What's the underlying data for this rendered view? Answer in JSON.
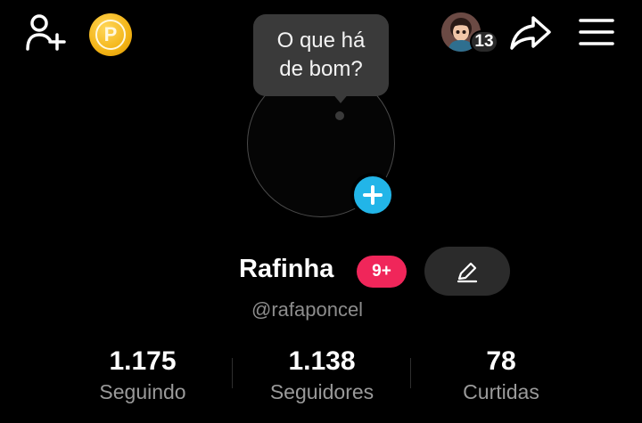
{
  "header": {
    "add_friend_icon": "add-user-icon",
    "coin_letter": "P",
    "story_count": "13",
    "share_icon": "share-icon",
    "menu_icon": "hamburger-menu-icon"
  },
  "avatar": {
    "bubble_text_line1": "O que há",
    "bubble_text_line2": "de bom?",
    "add_icon": "plus-icon"
  },
  "profile": {
    "name": "Rafinha",
    "badge": "9+",
    "handle": "@rafaponcel",
    "edit_icon": "pencil-icon"
  },
  "stats": [
    {
      "value": "1.175",
      "label": "Seguindo"
    },
    {
      "value": "1.138",
      "label": "Seguidores"
    },
    {
      "value": "78",
      "label": "Curtidas"
    }
  ],
  "colors": {
    "background": "#000000",
    "accent_blue": "#22b5e8",
    "badge_pink": "#f0265a",
    "coin_gold": "#f3b416",
    "muted_text": "#8d8d8d"
  }
}
